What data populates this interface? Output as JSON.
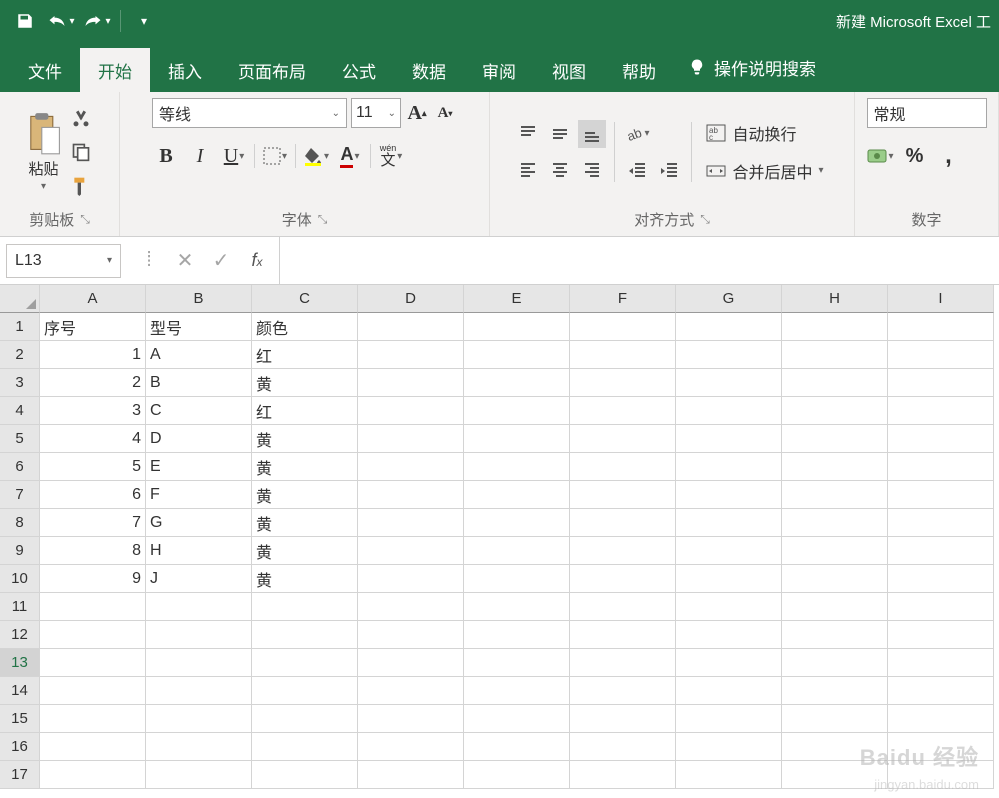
{
  "title": "新建 Microsoft Excel 工",
  "tabs": [
    "文件",
    "开始",
    "插入",
    "页面布局",
    "公式",
    "数据",
    "审阅",
    "视图",
    "帮助"
  ],
  "activeTab": "开始",
  "tellMe": "操作说明搜索",
  "ribbon": {
    "clipboard": {
      "label": "剪贴板",
      "paste": "粘贴"
    },
    "font": {
      "label": "字体",
      "name": "等线",
      "size": "11",
      "bold": "B",
      "italic": "I",
      "underline": "U",
      "wen": "wén",
      "wenChar": "文"
    },
    "alignment": {
      "label": "对齐方式",
      "wrap": "自动换行",
      "merge": "合并后居中"
    },
    "number": {
      "label": "数字",
      "format": "常规"
    }
  },
  "nameBox": "L13",
  "formula": "",
  "columns": [
    "A",
    "B",
    "C",
    "D",
    "E",
    "F",
    "G",
    "H",
    "I"
  ],
  "rows": [
    "1",
    "2",
    "3",
    "4",
    "5",
    "6",
    "7",
    "8",
    "9",
    "10",
    "11",
    "12",
    "13",
    "14",
    "15",
    "16",
    "17"
  ],
  "activeRow": 13,
  "data": {
    "headers": [
      "序号",
      "型号",
      "颜色"
    ],
    "rows": [
      {
        "n": "1",
        "m": "A",
        "c": "红"
      },
      {
        "n": "2",
        "m": "B",
        "c": "黄"
      },
      {
        "n": "3",
        "m": "C",
        "c": "红"
      },
      {
        "n": "4",
        "m": "D",
        "c": "黄"
      },
      {
        "n": "5",
        "m": "E",
        "c": "黄"
      },
      {
        "n": "6",
        "m": "F",
        "c": "黄"
      },
      {
        "n": "7",
        "m": "G",
        "c": "黄"
      },
      {
        "n": "8",
        "m": "H",
        "c": "黄"
      },
      {
        "n": "9",
        "m": "J",
        "c": "黄"
      }
    ]
  },
  "watermark": {
    "main": "Baidu 经验",
    "sub": "jingyan.baidu.com"
  }
}
